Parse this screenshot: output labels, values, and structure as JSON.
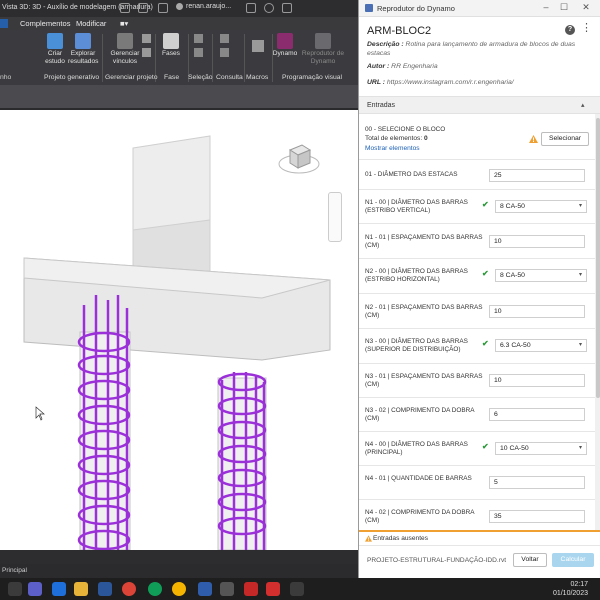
{
  "revit": {
    "title": "Vista 3D: 3D - Auxílio de modelagem (armadura)",
    "user": "renan.araujo...",
    "menu": [
      "Complementos",
      "Modificar"
    ],
    "ribbon_buttons": [
      {
        "label": "Criar\nestudo"
      },
      {
        "label": "Explorar\nresultados"
      },
      {
        "label": "Gerenciar\nvínculos"
      },
      {
        "label": "Fases"
      },
      {
        "label": "Dynamo"
      },
      {
        "label": "Reprodutor de\nDynamo"
      }
    ],
    "ribbon_groups": [
      "Projeto generativo",
      "Gerenciar projeto",
      "Fase",
      "Seleção",
      "Consulta",
      "Macros",
      "Programação visual"
    ],
    "left_label": "nho",
    "status_left": "Principal"
  },
  "taskbar": {
    "time": "02:17",
    "date": "01/10/2023"
  },
  "dynamo": {
    "window_title": "Reprodutor do Dynamo",
    "script_name": "ARM-BLOC2",
    "description_label": "Descrição :",
    "description": "Rotina para lançamento de armadura de blocos de duas estacas",
    "author_label": "Autor :",
    "author": "RR Engenharia",
    "url_label": "URL :",
    "url": "https://www.instagram.com/r.r.engenharia/",
    "section_title": "Entradas",
    "select_row": {
      "label": "00 - SELECIONE O BLOCO",
      "total_label": "Total de elementos:",
      "total_value": "0",
      "show_link": "Mostrar elementos",
      "button": "Selecionar"
    },
    "inputs": [
      {
        "label": "01 - DIÂMETRO DAS ESTACAS",
        "value": "25"
      },
      {
        "label": "N1 - 00 | DIÂMETRO DAS BARRAS (ESTRIBO VERTICAL)",
        "value": "8 CA-50"
      },
      {
        "label": "N1 - 01 | ESPAÇAMENTO DAS BARRAS (CM)",
        "value": "10"
      },
      {
        "label": "N2 - 00 | DIÂMETRO DAS BARRAS (ESTRIBO HORIZONTAL)",
        "value": "8 CA-50"
      },
      {
        "label": "N2 - 01 | ESPAÇAMENTO DAS BARRAS (CM)",
        "value": "10"
      },
      {
        "label": "N3 - 00 | DIÂMETRO DAS BARRAS (SUPERIOR DE DISTRIBUIÇÃO)",
        "value": "6.3 CA-50"
      },
      {
        "label": "N3 - 01 | ESPAÇAMENTO DAS BARRAS (CM)",
        "value": "10"
      },
      {
        "label": "N3 - 02 | COMPRIMENTO DA DOBRA (CM)",
        "value": "6"
      },
      {
        "label": "N4 - 00 | DIÂMETRO DAS BARRAS (PRINCIPAL)",
        "value": "10 CA-50"
      },
      {
        "label": "N4 - 01 | QUANTIDADE DE BARRAS",
        "value": "5"
      },
      {
        "label": "N4 - 02 | COMPRIMENTO DA DOBRA (CM)",
        "value": "35"
      }
    ],
    "missing_inputs": "Entradas ausentes",
    "file_name": "PROJETO-ESTRUTURAL-FUNDAÇÃO-IDD.rvt",
    "back_button": "Voltar",
    "run_button": "Calcular"
  },
  "colors": {
    "accent": "#1a5fb4",
    "check": "#2e9a3c",
    "warning": "#f0a030",
    "rebar": "#9b30d9"
  }
}
